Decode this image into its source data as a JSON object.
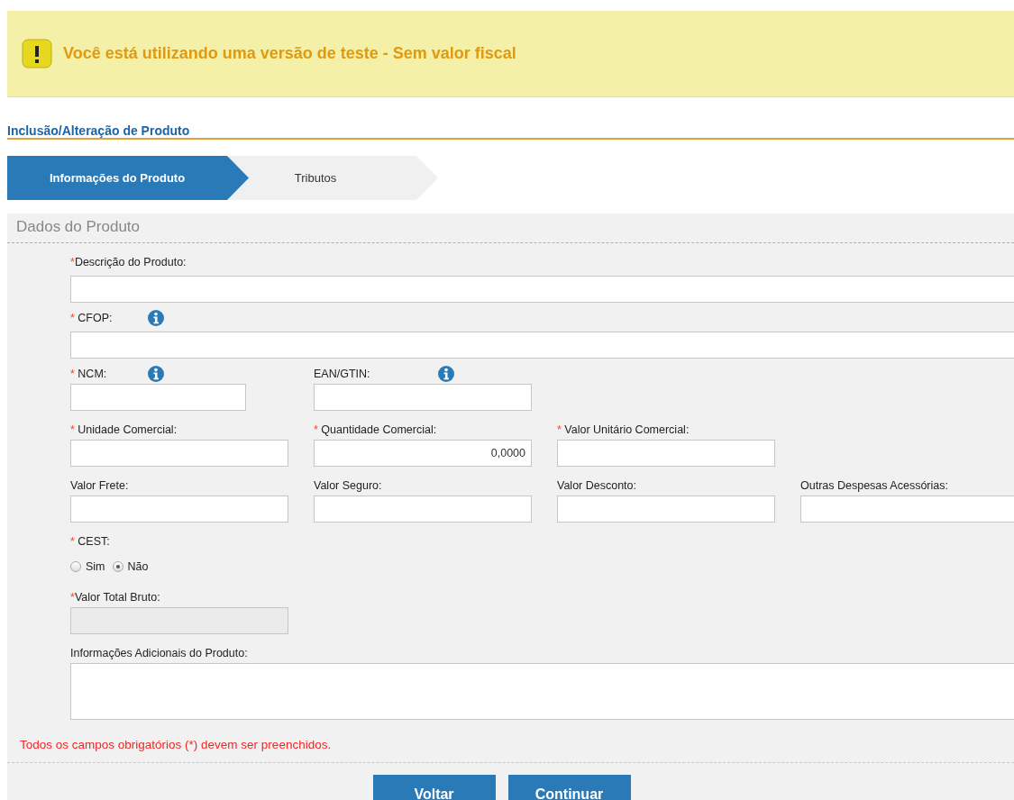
{
  "banner": {
    "text": "Você está utilizando uma versão de teste - Sem valor fiscal"
  },
  "page_title": "Inclusão/Alteração de Produto",
  "steps": [
    {
      "label": "Informações do Produto",
      "selected": true
    },
    {
      "label": "Tributos",
      "selected": false
    }
  ],
  "section_title": "Dados do Produto",
  "form": {
    "rows": [
      [
        {
          "kind": "wide",
          "required_mark": "*",
          "label": "Descrição do Produto:"
        }
      ],
      [
        {
          "kind": "wide",
          "required_mark": "* ",
          "label": "CFOP:",
          "info": true
        }
      ],
      [
        {
          "kind": "short",
          "required_mark": "* ",
          "label": "NCM:",
          "info": true
        },
        {
          "kind": "text",
          "label": "EAN/GTIN:",
          "info": true
        }
      ],
      [
        {
          "kind": "text",
          "required_mark": "* ",
          "label": "Unidade Comercial:"
        },
        {
          "kind": "number",
          "required_mark": "* ",
          "label": "Quantidade Comercial:",
          "value": "0,0000"
        },
        {
          "kind": "text",
          "required_mark": "* ",
          "label": "Valor Unitário Comercial:"
        }
      ],
      [
        {
          "kind": "text",
          "label": "Valor Frete:"
        },
        {
          "kind": "text",
          "label": "Valor Seguro:"
        },
        {
          "kind": "text",
          "label": "Valor Desconto:"
        },
        {
          "kind": "text",
          "label": "Outras Despesas Acessórias:"
        }
      ],
      [
        {
          "kind": "radio",
          "required_mark": "* ",
          "label": "CEST:",
          "options": [
            {
              "label": "Sim",
              "selected": false
            },
            {
              "label": "Não",
              "selected": true
            }
          ]
        }
      ],
      [
        {
          "kind": "text",
          "required_mark": "*",
          "label": "Valor Total Bruto:",
          "disabled": true
        }
      ],
      [
        {
          "kind": "textarea",
          "label": "Informações Adicionais do Produto:"
        }
      ]
    ]
  },
  "error_message": "Todos os campos obrigatórios (*) devem ser preenchidos.",
  "buttons": [
    "Voltar",
    "Continuar"
  ]
}
